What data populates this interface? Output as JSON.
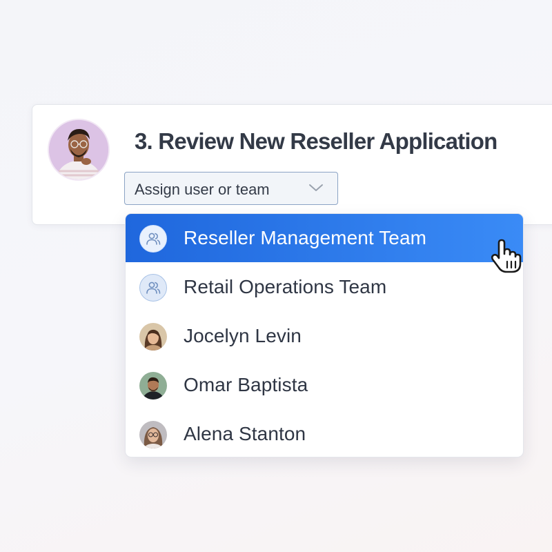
{
  "task": {
    "title": "3. Review New Reseller Application",
    "assign_placeholder": "Assign user or team"
  },
  "dropdown": {
    "options": [
      {
        "label": "Reseller Management Team",
        "kind": "team",
        "icon": "team-icon",
        "selected": true
      },
      {
        "label": "Retail Operations Team",
        "kind": "team",
        "icon": "team-icon"
      },
      {
        "label": "Jocelyn Levin",
        "kind": "user",
        "icon": "avatar"
      },
      {
        "label": "Omar Baptista",
        "kind": "user",
        "icon": "avatar"
      },
      {
        "label": "Alena Stanton",
        "kind": "user",
        "icon": "avatar"
      }
    ]
  },
  "colors": {
    "accent_start": "#1f67dd",
    "accent_end": "#3a8bf6",
    "text": "#2f3644",
    "title": "#333a47"
  }
}
